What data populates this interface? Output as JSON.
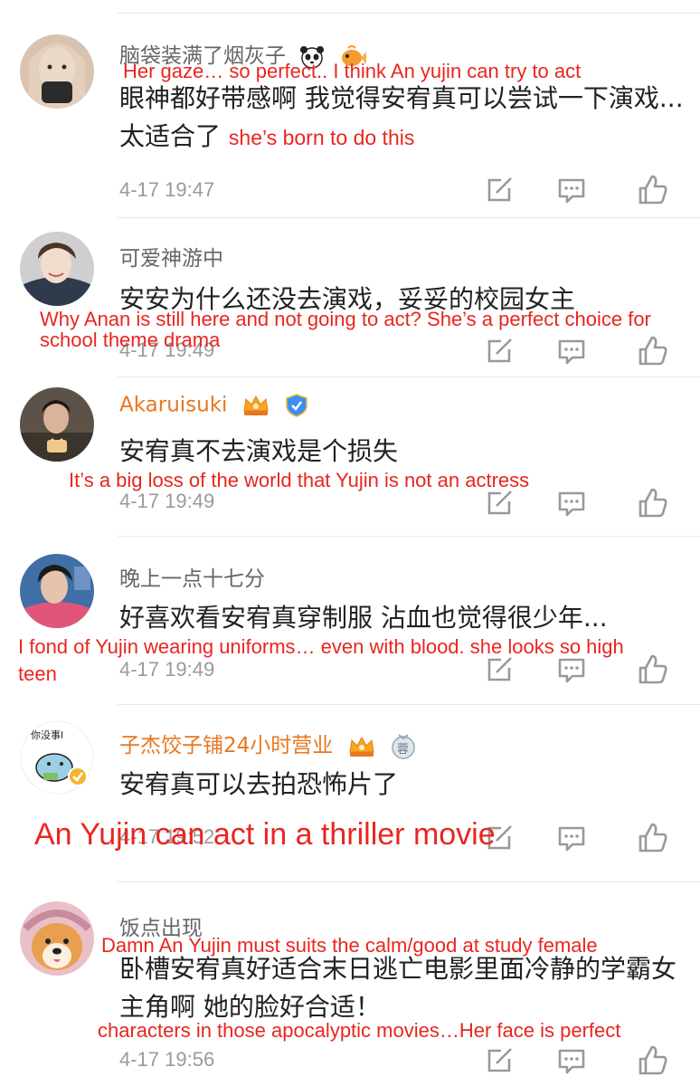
{
  "comments": [
    {
      "username": "脑袋装满了烟灰子",
      "text": "眼神都好带感啊 我觉得安宥真可以尝试一下演戏...太适合了",
      "inline_translation": "she’s born to do this",
      "time": "4-17 19:47",
      "translation": "Her gaze… so perfect.. I think An yujin can try to act",
      "badges": [
        "panda-emoji-icon",
        "fish-emoji-icon"
      ],
      "username_color": "#666666"
    },
    {
      "username": "可爱神游中",
      "text": "安安为什么还没去演戏，妥妥的校园女主",
      "time": "4-17 19:49",
      "translation_lines": [
        "Why Anan is still here and not going to act? She’s a perfect choice for",
        "school theme drama"
      ],
      "username_color": "#666666"
    },
    {
      "username": "Akaruisuki",
      "text": "安宥真不去演戏是个损失",
      "time": "4-17 19:49",
      "translation": "It’s a big loss of the world that Yujin is not an actress",
      "badges": [
        "vip-crown-icon",
        "verified-shield-icon"
      ],
      "username_color": "#e8771f"
    },
    {
      "username": "晚上一点十七分",
      "text": "好喜欢看安宥真穿制服 沾血也觉得很少年...",
      "time": "4-17 19:49",
      "translation_lines": [
        "I fond of Yujin wearing uniforms… even with blood. she looks so high",
        "teen"
      ],
      "username_color": "#666666"
    },
    {
      "username": "子杰饺子铺24小时营业",
      "text": "安宥真可以去拍恐怖片了",
      "time": "4-17 19:52",
      "translation": "An Yujin can act in a thriller movie",
      "badges": [
        "vip-crown-icon",
        "fan-medal-icon"
      ],
      "badge_medal_text": "蓉",
      "avatar_text": "你没事l",
      "username_color": "#e8771f"
    },
    {
      "username": "饭点出现",
      "text": "卧槽安宥真好适合末日逃亡电影里面冷静的学霸女主角啊 她的脸好合适！",
      "time": "4-17 19:56",
      "translation_top": "Damn An Yujin must suits the calm/good at study female",
      "translation_bottom": "characters in those apocalyptic movies…Her face is perfect",
      "username_color": "#666666"
    }
  ],
  "action_icons": [
    "share-icon",
    "reply-comment-icon",
    "like-thumb-icon"
  ],
  "colors": {
    "translation_red": "#e8261f",
    "vip_orange": "#e8771f",
    "timestamp_gray": "#9a9a9a"
  }
}
